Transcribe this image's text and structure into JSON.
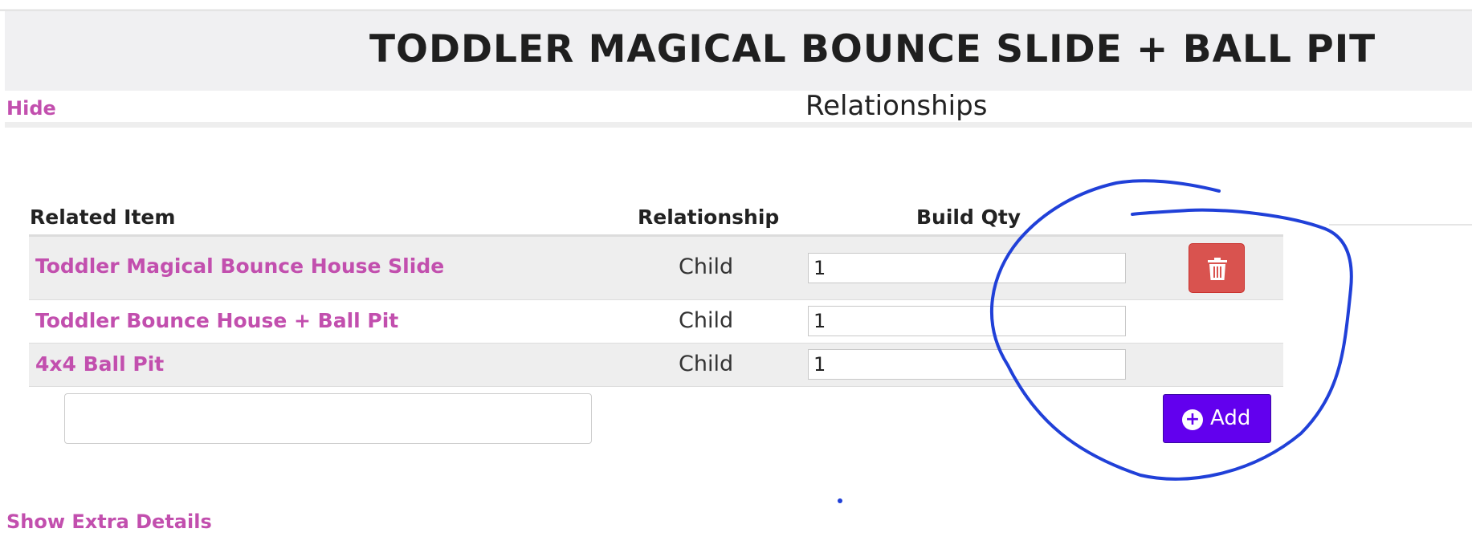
{
  "header": {
    "title": "TODDLER MAGICAL BOUNCE SLIDE + BALL PIT"
  },
  "section": {
    "toggle_label": "Hide",
    "title": "Relationships"
  },
  "table": {
    "columns": [
      "Related Item",
      "Relationship",
      "Build Qty"
    ],
    "rows": [
      {
        "item": "Toddler Magical Bounce House Slide",
        "relationship": "Child",
        "qty": "1"
      },
      {
        "item": "Toddler Bounce House + Ball Pit",
        "relationship": "Child",
        "qty": "1"
      },
      {
        "item": "4x4 Ball Pit",
        "relationship": "Child",
        "qty": "1"
      }
    ]
  },
  "new_item": {
    "value": ""
  },
  "actions": {
    "add_label": "Add",
    "add_icon": "plus-circle-icon",
    "delete_icon": "trash-icon"
  },
  "footer": {
    "extra_details_label": "Show Extra Details"
  },
  "colors": {
    "link": "#c24fae",
    "delete_button": "#d9534f",
    "add_button": "#6200ee",
    "annotation": "#2040d8"
  }
}
